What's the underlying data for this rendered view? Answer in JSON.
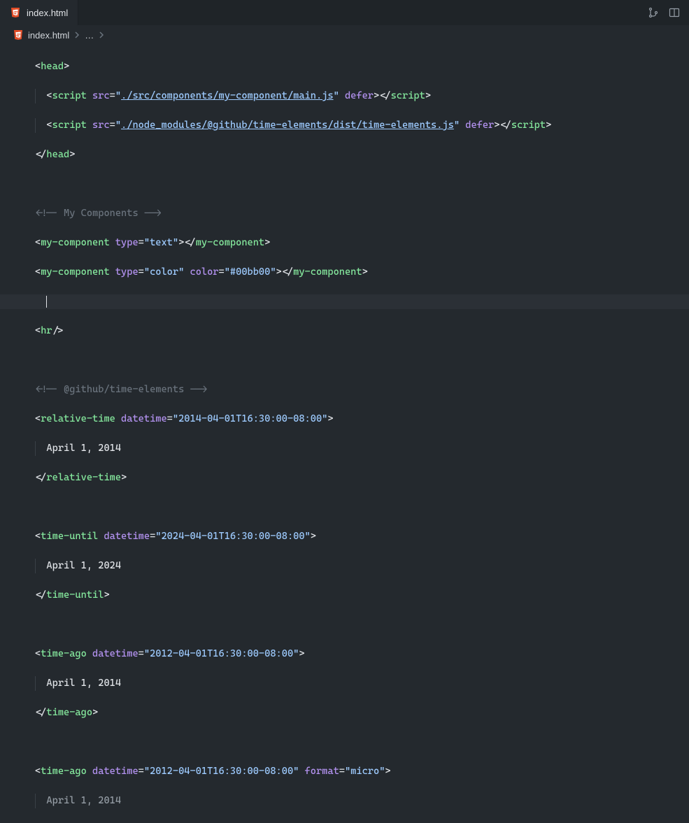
{
  "tab": {
    "label": "index.html"
  },
  "breadcrumb": {
    "file": "index.html",
    "ellipsis": "…"
  },
  "code": {
    "l1": {
      "tag_open": "<",
      "tag": "head",
      "tag_close": ">"
    },
    "l2": {
      "tag_open": "<",
      "tag": "script",
      "sp": " ",
      "attr1": "src",
      "eq": "=",
      "q": "\"",
      "val1": "./src/components/my-component/main.js",
      "attr2": "defer",
      "close1": "></",
      "close2": ">"
    },
    "l3": {
      "tag_open": "<",
      "tag": "script",
      "sp": " ",
      "attr1": "src",
      "eq": "=",
      "q": "\"",
      "val1": "./node_modules/@github/time-elements/dist/time-elements.js",
      "attr2": "defer",
      "close1": "></",
      "close2": ">"
    },
    "l4": {
      "tag_open": "</",
      "tag": "head",
      "tag_close": ">"
    },
    "l6": {
      "comment": "<!-- My Components -->"
    },
    "l7": {
      "tag_open": "<",
      "tag": "my-component",
      "attr1": "type",
      "eq": "=",
      "q": "\"",
      "val1": "text",
      "close_open": "></",
      "tag_close": ">"
    },
    "l8": {
      "tag_open": "<",
      "tag": "my-component",
      "attr1": "type",
      "eq": "=",
      "q": "\"",
      "val1": "color",
      "attr2": "color",
      "val2": "#00bb00",
      "close_open": "></",
      "tag_close": ">"
    },
    "l10": {
      "tag_open": "<",
      "tag": "hr",
      "tag_close": "/>"
    },
    "l12": {
      "comment": "<!-- @github/time-elements -->"
    },
    "l13": {
      "tag_open": "<",
      "tag": "relative-time",
      "attr1": "datetime",
      "eq": "=",
      "q": "\"",
      "val1": "2014-04-01T16:30:00-08:00",
      "tag_close": ">"
    },
    "l14": {
      "text": "April 1, 2014"
    },
    "l15": {
      "tag_open": "</",
      "tag": "relative-time",
      "tag_close": ">"
    },
    "l17": {
      "tag_open": "<",
      "tag": "time-until",
      "attr1": "datetime",
      "eq": "=",
      "q": "\"",
      "val1": "2024-04-01T16:30:00-08:00",
      "tag_close": ">"
    },
    "l18": {
      "text": "April 1, 2024"
    },
    "l19": {
      "tag_open": "</",
      "tag": "time-until",
      "tag_close": ">"
    },
    "l21": {
      "tag_open": "<",
      "tag": "time-ago",
      "attr1": "datetime",
      "eq": "=",
      "q": "\"",
      "val1": "2012-04-01T16:30:00-08:00",
      "tag_close": ">"
    },
    "l22": {
      "text": "April 1, 2014"
    },
    "l23": {
      "tag_open": "</",
      "tag": "time-ago",
      "tag_close": ">"
    },
    "l25": {
      "tag_open": "<",
      "tag": "time-ago",
      "attr1": "datetime",
      "eq": "=",
      "q": "\"",
      "val1": "2012-04-01T16:30:00-08:00",
      "attr2": "format",
      "val2": "micro",
      "tag_close": ">"
    },
    "l26": {
      "text": "April 1, 2014"
    }
  }
}
